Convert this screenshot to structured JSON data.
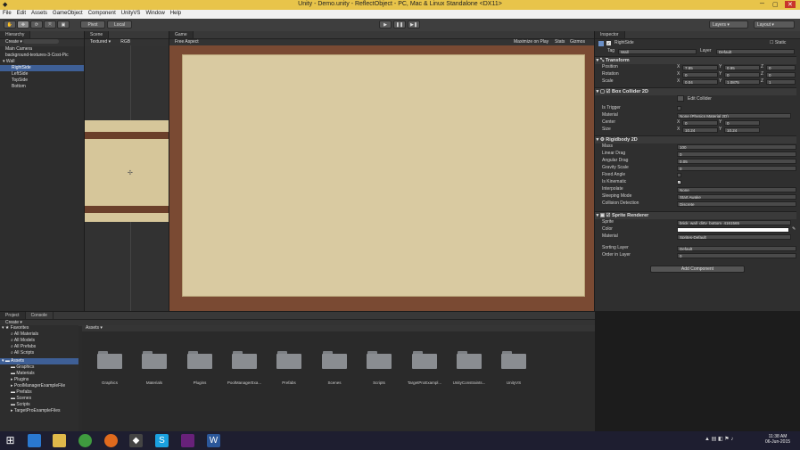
{
  "window": {
    "title": "Unity - Demo.unity - ReflectObject - PC, Mac & Linux Standalone <DX11>"
  },
  "menu": [
    "File",
    "Edit",
    "Assets",
    "GameObject",
    "Component",
    "UnityVS",
    "Window",
    "Help"
  ],
  "toolbar": {
    "pivot": "Pivot",
    "local": "Local",
    "layers": "Layers",
    "layout": "Layout"
  },
  "hierarchy": {
    "tab": "Hierarchy",
    "create": "Create",
    "items": [
      "Main Camera",
      "background-textures-3-Cost-Pic",
      "Wall",
      "RightSide",
      "LeftSide",
      "TopSide",
      "Bottom"
    ]
  },
  "scene": {
    "tab": "Scene",
    "mode": "Textured",
    "rgb": "RGB"
  },
  "game": {
    "tab": "Game",
    "aspect": "Free Aspect",
    "maximize": "Maximize on Play",
    "stats": "Stats",
    "gizmos": "Gizmos"
  },
  "inspector": {
    "tab": "Inspector",
    "object_name": "RightSide",
    "static": "Static",
    "tag_label": "Tag",
    "tag_value": "Wall",
    "layer_label": "Layer",
    "layer_value": "Default",
    "transform": {
      "header": "Transform",
      "position_label": "Position",
      "pos": [
        "7.85",
        "0.95",
        "0"
      ],
      "rotation_label": "Rotation",
      "rot": [
        "0",
        "0",
        "0"
      ],
      "scale_label": "Scale",
      "scale": [
        "0.04",
        "1.0875",
        "1"
      ]
    },
    "box_collider": {
      "header": "Box Collider 2D",
      "edit": "Edit Collider",
      "is_trigger": "Is Trigger",
      "material_label": "Material",
      "material": "None (Physics Material 2D)",
      "center_label": "Center",
      "center": [
        "0",
        "0"
      ],
      "size_label": "Size",
      "size": [
        "10.24",
        "10.24"
      ]
    },
    "rigidbody": {
      "header": "Rigidbody 2D",
      "mass_label": "Mass",
      "mass": "100",
      "linear_drag_label": "Linear Drag",
      "linear_drag": "0",
      "angular_drag_label": "Angular Drag",
      "angular_drag": "0.05",
      "gravity_label": "Gravity Scale",
      "gravity": "0",
      "fixed_angle_label": "Fixed Angle",
      "kinematic_label": "Is Kinematic",
      "interpolate_label": "Interpolate",
      "interpolate": "None",
      "sleeping_label": "Sleeping Mode",
      "sleeping": "Start Awake",
      "collision_label": "Collision Detection",
      "collision": "Discrete"
    },
    "sprite_renderer": {
      "header": "Sprite Renderer",
      "sprite_label": "Sprite",
      "sprite": "brick_wall_dirty_bottom_4161565",
      "color_label": "Color",
      "material_label": "Material",
      "material": "Sprites-Default",
      "sorting_label": "Sorting Layer",
      "sorting": "Default",
      "order_label": "Order in Layer",
      "order": "0"
    },
    "add_component": "Add Component"
  },
  "project": {
    "tab": "Project",
    "console_tab": "Console",
    "create": "Create",
    "favorites_label": "Favorites",
    "favorites": [
      "All Materials",
      "All Models",
      "All Prefabs",
      "All Scripts"
    ],
    "assets_label": "Assets",
    "tree": [
      "Graphics",
      "Materials",
      "Plugins",
      "PoolManagerExampleFile",
      "Prefabs",
      "Scenes",
      "Scripts",
      "TargetProExampleFiles"
    ],
    "breadcrumb": "Assets",
    "folders": [
      "Graphics",
      "Materials",
      "Plugins",
      "PoolManagerExa...",
      "Prefabs",
      "Scenes",
      "Scripts",
      "TargetProExampl...",
      "UnityConstraints...",
      "UnityVS"
    ]
  },
  "taskbar": {
    "time": "11:38 AM",
    "date": "06-Jun-2015"
  },
  "colors": {
    "accent": "#3e5f96",
    "titlebar": "#e8c44a",
    "parchment": "#d8c9a0",
    "brick": "#7a4a33"
  }
}
